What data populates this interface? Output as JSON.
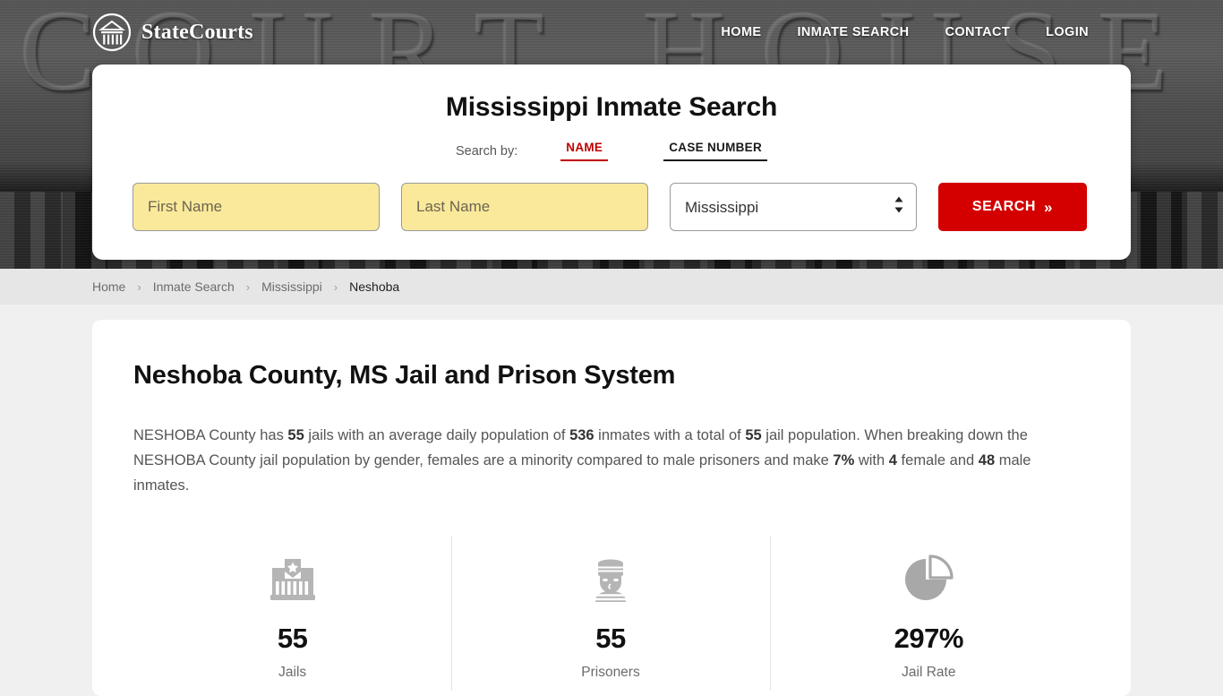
{
  "brand": {
    "name": "StateCourts",
    "logo_icon": "courthouse-circle-icon"
  },
  "nav": [
    {
      "label": "HOME"
    },
    {
      "label": "INMATE SEARCH"
    },
    {
      "label": "CONTACT"
    },
    {
      "label": "LOGIN"
    }
  ],
  "hero": {
    "background_text": "COURT HOUSE"
  },
  "search": {
    "title": "Mississippi Inmate Search",
    "search_by_label": "Search by:",
    "tabs": [
      {
        "label": "NAME",
        "active": true,
        "color": "#c00000"
      },
      {
        "label": "CASE NUMBER",
        "active": false,
        "color": "#1a1a1a"
      }
    ],
    "first_name": {
      "value": "",
      "placeholder": "First Name"
    },
    "last_name": {
      "value": "",
      "placeholder": "Last Name"
    },
    "state_select": {
      "value": "Mississippi",
      "options": [
        "Mississippi"
      ]
    },
    "submit_label": "SEARCH",
    "submit_chevron": "»",
    "submit_color": "#d40000",
    "field_fill_color": "#fbe99b"
  },
  "breadcrumb": [
    {
      "label": "Home",
      "current": false
    },
    {
      "label": "Inmate Search",
      "current": false
    },
    {
      "label": "Mississippi",
      "current": false
    },
    {
      "label": "Neshoba",
      "current": true
    }
  ],
  "breadcrumb_separator": "›",
  "content": {
    "title": "Neshoba County, MS Jail and Prison System",
    "summary": {
      "p1": "NESHOBA County has ",
      "b1": "55",
      "p2": " jails with an average daily population of ",
      "b2": "536",
      "p3": " inmates with a total of ",
      "b3": "55",
      "p4": " jail population. When breaking down the NESHOBA County jail population by gender, females are a minority compared to male prisoners and make ",
      "b4": "7%",
      "p5": " with ",
      "b5": "4",
      "p6": " female and ",
      "b6": "48",
      "p7": " male inmates."
    },
    "stats": [
      {
        "icon": "jail-building-icon",
        "value": "55",
        "label": "Jails"
      },
      {
        "icon": "prisoner-icon",
        "value": "55",
        "label": "Prisoners"
      },
      {
        "icon": "pie-chart-icon",
        "value": "297%",
        "label": "Jail Rate"
      }
    ]
  }
}
